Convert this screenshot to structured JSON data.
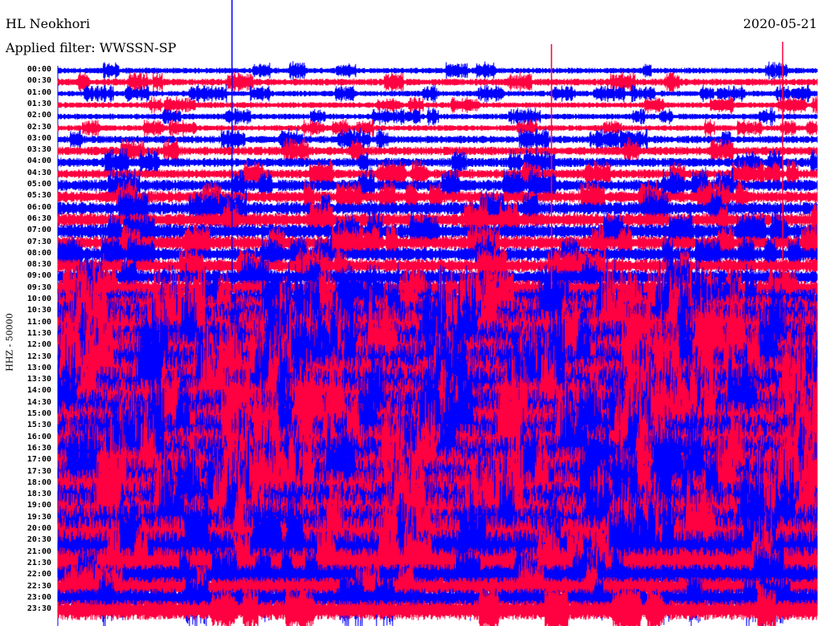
{
  "header": {
    "station": "HL Neokhori",
    "filter": "Applied filter: WWSSN-SP",
    "date": "2020-05-21"
  },
  "chart_data": {
    "type": "line",
    "title": "HL Neokhori",
    "ylabel": "HHZ - 50000",
    "row_labels": [
      "00:00",
      "00:30",
      "01:00",
      "01:30",
      "02:00",
      "02:30",
      "03:00",
      "03:30",
      "04:00",
      "04:30",
      "05:00",
      "05:30",
      "06:00",
      "06:30",
      "07:00",
      "07:30",
      "08:00",
      "08:30",
      "09:00",
      "09:30",
      "10:00",
      "10:30",
      "11:00",
      "11:30",
      "12:00",
      "12:30",
      "13:00",
      "13:30",
      "14:00",
      "14:30",
      "15:00",
      "15:30",
      "16:00",
      "16:30",
      "17:00",
      "17:30",
      "18:00",
      "18:30",
      "19:00",
      "19:30",
      "20:00",
      "20:30",
      "21:00",
      "21:30",
      "22:00",
      "22:30",
      "23:00",
      "23:30"
    ],
    "row_activity": [
      1,
      1.2,
      1,
      1,
      1,
      1,
      1.3,
      1.5,
      1.6,
      1.6,
      2,
      2,
      2.2,
      2.4,
      2.5,
      2.4,
      2.3,
      2.3,
      2.5,
      3,
      4,
      6,
      8,
      9,
      9,
      9,
      9,
      9,
      9,
      9,
      9,
      9,
      9,
      9,
      9,
      9,
      9,
      9,
      9,
      9,
      9,
      9,
      8,
      6,
      4,
      3.5,
      3.5,
      3.5
    ],
    "series_colors": [
      "#0000ff",
      "#ff0040"
    ]
  }
}
